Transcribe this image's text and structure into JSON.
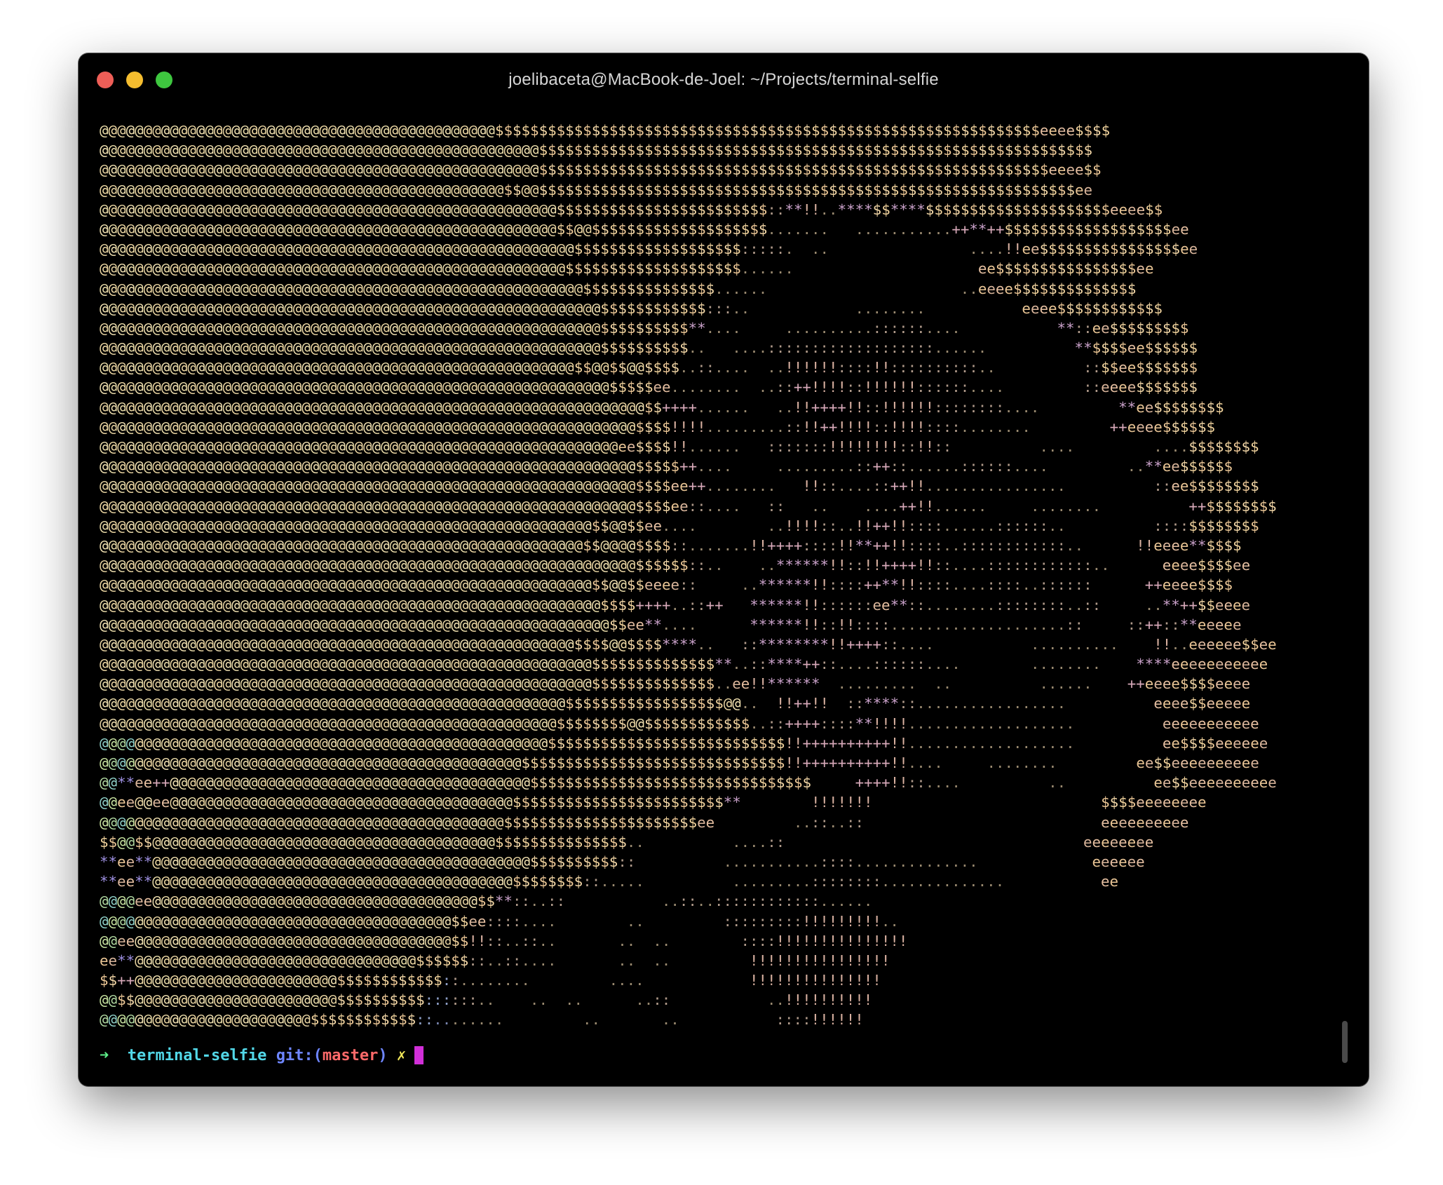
{
  "window": {
    "title": "joelibaceta@MacBook-de-Joel: ~/Projects/terminal-selfie",
    "buttons": {
      "close_color": "#ee5e57",
      "minimize_color": "#f5bd2f",
      "zoom_color": "#3ec73f"
    }
  },
  "colors": {
    "background": "#000000",
    "art_default": "#e8d4a6",
    "prompt_arrow": "#5ef08a",
    "prompt_dir": "#52d7e7",
    "prompt_git": "#6e86ff",
    "prompt_branch": "#ff6a6a",
    "prompt_dirty": "#f2e85a",
    "cursor": "#d12fd8"
  },
  "ascii_art": [
    "@@@@@@@@@@@@@@@@@@@@@@@@@@@@@@@@@@@@@@@@@@@@@$$$$$$$$$$$$$$$$$$$$$$$$$$$$$$$$$$$$$$$$$$$$$$$$$$$$$$$$$$$$$$eeee$$$$",
    "@@@@@@@@@@@@@@@@@@@@@@@@@@@@@@@@@@@@@@@@@@@@@@@@@@$$$$$$$$$$$$$$$$$$$$$$$$$$$$$$$$$$$$$$$$$$$$$$$$$$$$$$$$$$$$$$$",
    "@@@@@@@@@@@@@@@@@@@@@@@@@@@@@@@@@@@@@@@@@@@@@@@@@@$$$$$$$$$$$$$$$$$$$$$$$$$$$$$$$$$$$$$$$$$$$$$$$$$$$$$$$$$$eeee$$",
    "@@@@@@@@@@@@@@@@@@@@@@@@@@@@@@@@@@@@@@@@@@@@@@$$@@$$$$$$$$$$$$$$$$$$$$$$$$$$$$$$$$$$$$$$$$$$$$$$$$$$$$$$$$$$$$$ee",
    "@@@@@@@@@@@@@@@@@@@@@@@@@@@@@@@@@@@@@@@@@@@@@@@@@@@@$$$$$$$$$$$$$$$$$$$$$$$$::**!!..****$$****$$$$$$$$$$$$$$$$$$$$$eeee$$",
    "@@@@@@@@@@@@@@@@@@@@@@@@@@@@@@@@@@@@@@@@@@@@@@@@@@@@$$@@$$$$$$$$$$$$$$$$$$$$.......   ...........++**++$$$$$$$$$$$$$$$$$$$ee",
    "@@@@@@@@@@@@@@@@@@@@@@@@@@@@@@@@@@@@@@@@@@@@@@@@@@@@@@$$$$$$$$$$$$$$$$$$$:::::.  ..                ....!!ee$$$$$$$$$$$$$$$$ee",
    "@@@@@@@@@@@@@@@@@@@@@@@@@@@@@@@@@@@@@@@@@@@@@@@@@@@@@$$$$$$$$$$$$$$$$$$$$......                     ee$$$$$$$$$$$$$$$$ee",
    "@@@@@@@@@@@@@@@@@@@@@@@@@@@@@@@@@@@@@@@@@@@@@@@@@@@@@@@$$$$$$$$$$$$$$$......                      ..eeee$$$$$$$$$$$$$$",
    "@@@@@@@@@@@@@@@@@@@@@@@@@@@@@@@@@@@@@@@@@@@@@@@@@@@@@@@@@$$$$$$$$$$$$:::..            ........           eeee$$$$$$$$$$$$",
    "@@@@@@@@@@@@@@@@@@@@@@@@@@@@@@@@@@@@@@@@@@@@@@@@@@@@@@@@@$$$$$$$$$$**....     ..........::::::....           **::ee$$$$$$$$$",
    "@@@@@@@@@@@@@@@@@@@@@@@@@@@@@@@@@@@@@@@@@@@@@@@@@@@@@@@@@$$$$$$$$$$..   ....:::::::::::::::::::......          **$$$$ee$$$$$$",
    "@@@@@@@@@@@@@@@@@@@@@@@@@@@@@@@@@@@@@@@@@@@@@@@@@@@@@@$$@@$$@@$$$$..::....  ..!!!!!!::::!!::::::::::..          ::$$ee$$$$$$$",
    "@@@@@@@@@@@@@@@@@@@@@@@@@@@@@@@@@@@@@@@@@@@@@@@@@@@@@@@@@@$$$$$ee........  ..::++!!!!::!!!!!!::::::....         ::eeee$$$$$$$",
    "@@@@@@@@@@@@@@@@@@@@@@@@@@@@@@@@@@@@@@@@@@@@@@@@@@@@@@@@@@@@@@$$++++......   ..!!++++!!::!!!!!!::::::::....         **ee$$$$$$$$",
    "@@@@@@@@@@@@@@@@@@@@@@@@@@@@@@@@@@@@@@@@@@@@@@@@@@@@@@@@@@@@@$$$$!!!!.........::!!++!!!!::!!!!::::........         ++eeee$$$$$$",
    "@@@@@@@@@@@@@@@@@@@@@@@@@@@@@@@@@@@@@@@@@@@@@@@@@@@@@@@@@@@ee$$$$!!......   :::::::!!!!!!!!::!!::          ....         ....$$$$$$$$",
    "@@@@@@@@@@@@@@@@@@@@@@@@@@@@@@@@@@@@@@@@@@@@@@@@@@@@@@@@@@@@@$$$$$++....     .........::++::......::::::....         ..**ee$$$$$$",
    "@@@@@@@@@@@@@@@@@@@@@@@@@@@@@@@@@@@@@@@@@@@@@@@@@@@@@@@@@@@@@$$$$ee++........   !!::....::++!!................          ::ee$$$$$$$$",
    "@@@@@@@@@@@@@@@@@@@@@@@@@@@@@@@@@@@@@@@@@@@@@@@@@@@@@@@@@@@@@$$$$ee::....   ::   ..    ....++!!......     ........          ++$$$$$$$$",
    "@@@@@@@@@@@@@@@@@@@@@@@@@@@@@@@@@@@@@@@@@@@@@@@@@@@@@@@@$$@@$$ee....        ..!!!!::..!!++!!::::......::::::..          ::::$$$$$$$$",
    "@@@@@@@@@@@@@@@@@@@@@@@@@@@@@@@@@@@@@@@@@@@@@@@@@@@@@@@$$@@@@$$$$::.......!!++++::::!!**++!!::::..::::::::::::..      !!eeee**$$$$",
    "@@@@@@@@@@@@@@@@@@@@@@@@@@@@@@@@@@@@@@@@@@@@@@@@@@@@@@@@@@@@@$$$$$$::..    ..******!!::!!++++!!::....::::::::::::..      eeee$$$$ee",
    "@@@@@@@@@@@@@@@@@@@@@@@@@@@@@@@@@@@@@@@@@@@@@@@@@@@@@@@@$$@@$$eeee::     ..******!!::::++**!!::::....::::..::::::      ++eeee$$$$",
    "@@@@@@@@@@@@@@@@@@@@@@@@@@@@@@@@@@@@@@@@@@@@@@@@@@@@@@@@@$$$$++++..::++   ******!!::::::ee**::........::::::::..::     ..**++$$eeee",
    "@@@@@@@@@@@@@@@@@@@@@@@@@@@@@@@@@@@@@@@@@@@@@@@@@@@@@@@@@@$$ee**....      ******!!::!!::::....................::     ::++::**eeeee",
    "@@@@@@@@@@@@@@@@@@@@@@@@@@@@@@@@@@@@@@@@@@@@@@@@@@@@@@$$$$@@$$$$****..   ::********!!++++::....           ..........    !!..eeeeee$$ee",
    "@@@@@@@@@@@@@@@@@@@@@@@@@@@@@@@@@@@@@@@@@@@@@@@@@@@@@@@@$$$$$$$$$$$$$$**..::****++::....::::::....        ........    ****eeeeeeeeeee",
    "@@@@@@@@@@@@@@@@@@@@@@@@@@@@@@@@@@@@@@@@@@@@@@@@@@@@@@@@$$$$$$$$$$$$$$..ee!!******  .........  ..          ......    ++eeee$$$$eeee",
    "@@@@@@@@@@@@@@@@@@@@@@@@@@@@@@@@@@@@@@@@@@@@@@@@@@@@@$$$$$$$$$$$$$$$$$$@@..  !!++!!  ::****::.................          eeee$$eeeee",
    "@@@@@@@@@@@@@@@@@@@@@@@@@@@@@@@@@@@@@@@@@@@@@@@@@@@@$$$$$$$$@@$$$$$$$$$$$$..::++++::::**!!!!...................          eeeeeeeeeee",
    "@@@@@@@@@@@@@@@@@@@@@@@@@@@@@@@@@@@@@@@@@@@@@@@@@@@$$$$$$$$$$$$$$$$$$$$$$$$$$$!!++++++++++!!...................          ee$$$$eeeeee",
    "@@@@@@@@@@@@@@@@@@@@@@@@@@@@@@@@@@@@@@@@@@@@@@@@$$$$$$$$$$$$$$$$$$$$$$$$$$$$$$!!++++++++++!!....     ........         ee$$eeeeeeeeee",
    "@@**ee++@@@@@@@@@@@@@@@@@@@@@@@@@@@@@@@@@@@@@@@@@$$$$$$$$$$$$$$$$$$$$$$$$$$$$$$$$     ++++!!::....          ..          ee$$eeeeeeeeee",
    "@@ee@@ee@@@@@@@@@@@@@@@@@@@@@@@@@@@@@@@@@@@@@@@$$$$$$$$$$$$$$$$$$$$$$$$**        !!!!!!!                          $$$$eeeeeeee",
    "@@@@@@@@@@@@@@@@@@@@@@@@@@@@@@@@@@@@@@@@@@@@@@$$$$$$$$$$$$$$$$$$$$$$ee         ..::..::                           eeeeeeeeee",
    "$$@@$$@@@@@@@@@@@@@@@@@@@@@@@@@@@@@@@@@@@@@@@$$$$$$$$$$$$$$$..          ....::                                  eeeeeeee",
    "**ee**@@@@@@@@@@@@@@@@@@@@@@@@@@@@@@@@@@@@@@@@@@@$$$$$$$$$$::          ...........::::..............             eeeeee",
    "**ee**@@@@@@@@@@@@@@@@@@@@@@@@@@@@@@@@@@@@@@@@@$$$$$$$$::.....          .........::::::::..............           ee",
    "@@@@ee@@@@@@@@@@@@@@@@@@@@@@@@@@@@@@@@@@@@@$$**::..::           ..::..::::::::::::......",
    "@@@@@@@@@@@@@@@@@@@@@@@@@@@@@@@@@@@@@@@@$$ee::::....        ..         :::::::::!!!!!!!!!..",
    "@@ee@@@@@@@@@@@@@@@@@@@@@@@@@@@@@@@@@@@@$$!!::..::..       ..  ..        ::::!!!!!!!!!!!!!!!",
    "ee**@@@@@@@@@@@@@@@@@@@@@@@@@@@@@@@@$$$$$$::..::....       ..  ..         !!!!!!!!!!!!!!!!",
    "$$++@@@@@@@@@@@@@@@@@@@@@@@$$$$$$$$$$$$::........         ....            !!!!!!!!!!!!!!!",
    "@@$$@@@@@@@@@@@@@@@@@@@@@@@$$$$$$$$$$::::::..    ..  ..      ..::           ..!!!!!!!!!!",
    "@@@@@@@@@@@@@@@@@@@@@@@@$$$$$$$$$$$$::........         ..       ..           ::::!!!!!!"
  ],
  "prompt": {
    "arrow": "➜",
    "directory": "terminal-selfie",
    "git_label": "git:(",
    "branch": "master",
    "git_close": ")",
    "dirty_marker": "✗"
  }
}
